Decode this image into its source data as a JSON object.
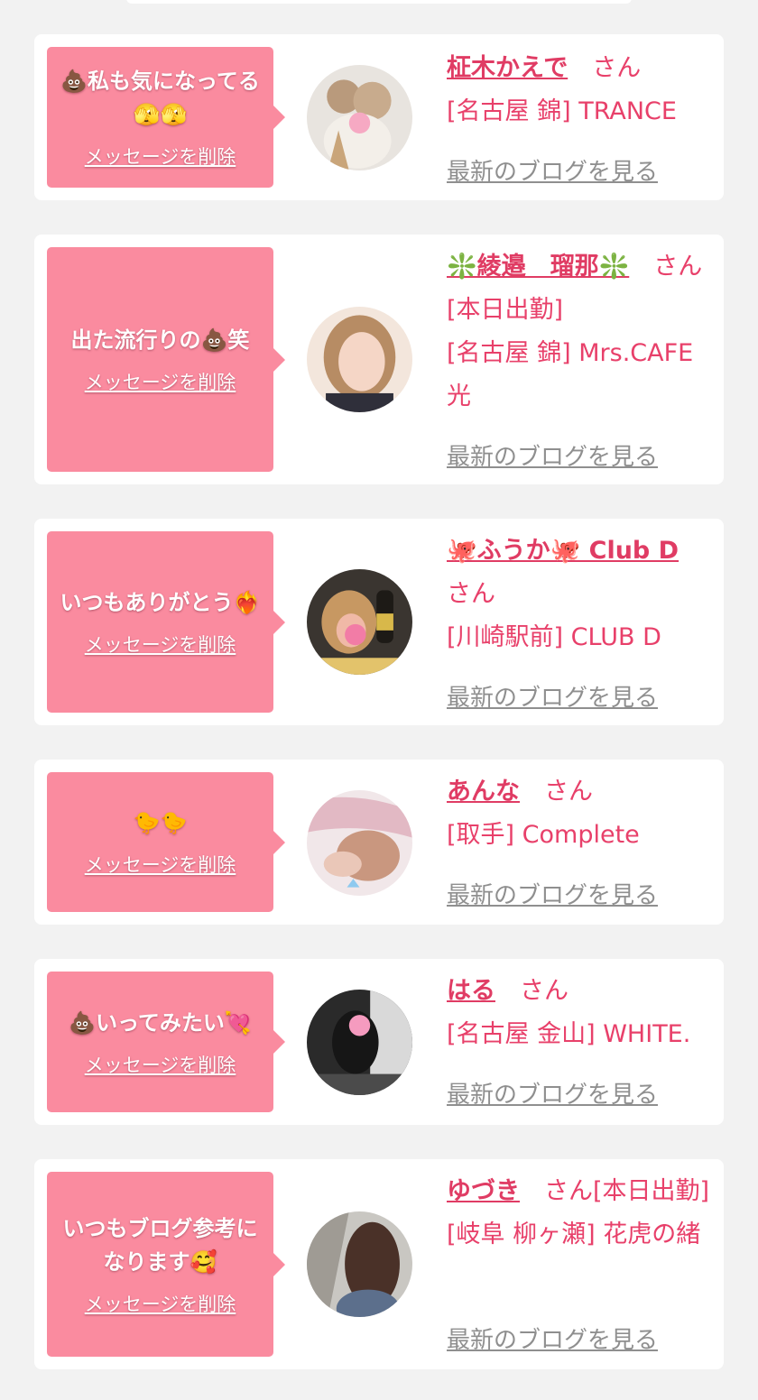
{
  "delete_label": "メッセージを削除",
  "blog_label": "最新のブログを見る",
  "colors": {
    "background": "#f2f2f2",
    "card": "#ffffff",
    "bubble": "#fa8b9f",
    "name": "#e03c64",
    "text": "#e8406a",
    "blog_link": "#8f8f8f"
  },
  "cards": [
    {
      "message": "💩私も気になってる🫣🫣",
      "name": "柾木かえで",
      "honorific": "　さん",
      "shop": "[名古屋 錦] TRANCE",
      "avatar_icon": "photo-avatar"
    },
    {
      "message": "出た流行りの💩笑",
      "name": "❇️綾邉　瑠那❇️",
      "honorific": "　さん[本日出勤]",
      "shop": "[名古屋 錦] Mrs.CAFE 光",
      "avatar_icon": "photo-avatar"
    },
    {
      "message": "いつもありがとう❤️‍🔥",
      "name": "🐙ふうか🐙 Club D",
      "honorific": "さん",
      "shop": "[川崎駅前] CLUB D",
      "avatar_icon": "photo-avatar"
    },
    {
      "message": "🐤🐤",
      "name": "あんな",
      "honorific": "　さん",
      "shop": "[取手] Complete",
      "avatar_icon": "photo-avatar"
    },
    {
      "message": "💩いってみたい💘",
      "name": "はる",
      "honorific": "　さん",
      "shop": "[名古屋 金山] WHITE.",
      "avatar_icon": "photo-avatar"
    },
    {
      "message": "いつもブログ参考になります🥰",
      "name": "ゆづき",
      "honorific": "　さん[本日出勤]",
      "shop": "[岐阜 柳ヶ瀬] 花虎の緒",
      "avatar_icon": "photo-avatar"
    }
  ]
}
